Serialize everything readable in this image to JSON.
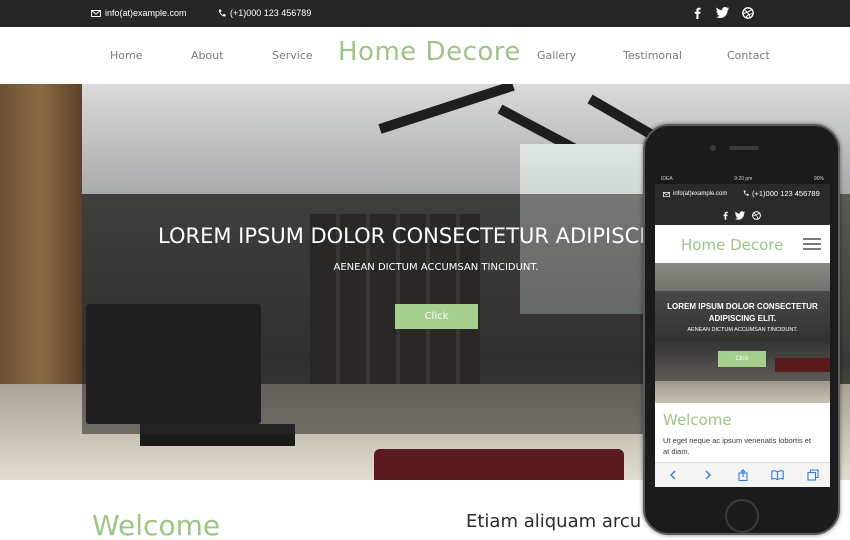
{
  "topbar": {
    "email": "info(at)example.com",
    "phone": "(+1)000 123 456789",
    "social": [
      "facebook-icon",
      "twitter-icon",
      "dribbble-icon"
    ]
  },
  "nav": {
    "items": [
      {
        "label": "Home"
      },
      {
        "label": "About"
      },
      {
        "label": "Service"
      },
      {
        "label": "Gallery"
      },
      {
        "label": "Testimonal"
      },
      {
        "label": "Contact"
      }
    ],
    "brand": "Home Decore"
  },
  "hero": {
    "headline": "LOREM IPSUM DOLOR CONSECTETUR ADIPISCIN",
    "subheadline": "AENEAN DICTUM ACCUMSAN TINCIDUNT.",
    "button": "Click"
  },
  "welcome": {
    "title": "Welcome",
    "side_heading": "Etiam aliquam arcu v"
  },
  "phone": {
    "status_left": "IDEA",
    "status_time": "9:20 pm",
    "status_battery": "90%",
    "email": "info(at)example.com",
    "phone": "(+1)000 123 456789",
    "brand": "Home Decore",
    "hero_headline": "LOREM IPSUM DOLOR CONSECTETUR ADIPISCING ELIT.",
    "hero_sub": "AENEAN DICTUM ACCUMSAN TINCIDUNT.",
    "hero_button": "Click",
    "welcome_title": "Welcome",
    "welcome_text": "Ut eget neque ac ipsum venenatis lobortis et at diam."
  },
  "colors": {
    "accent": "#9ec486",
    "button": "#a4cf8e",
    "topbar": "#262626"
  }
}
